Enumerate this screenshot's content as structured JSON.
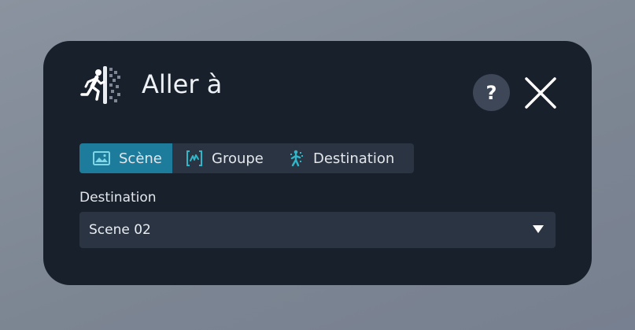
{
  "dialog": {
    "title": "Aller à",
    "title_icon": "runner-portal-icon",
    "help_label": "?",
    "close_icon": "close-icon"
  },
  "tabs": [
    {
      "label": "Scène",
      "icon": "image-icon",
      "active": true
    },
    {
      "label": "Groupe",
      "icon": "group-wave-icon",
      "active": false
    },
    {
      "label": "Destination",
      "icon": "destination-figure-icon",
      "active": false
    }
  ],
  "destination_field": {
    "label": "Destination",
    "value": "Scene 02",
    "caret_icon": "caret-down-icon"
  },
  "colors": {
    "accent": "#1d7c9b",
    "icon_teal": "#2fb6c9",
    "panel": "#18202c",
    "control": "#2b3442"
  }
}
